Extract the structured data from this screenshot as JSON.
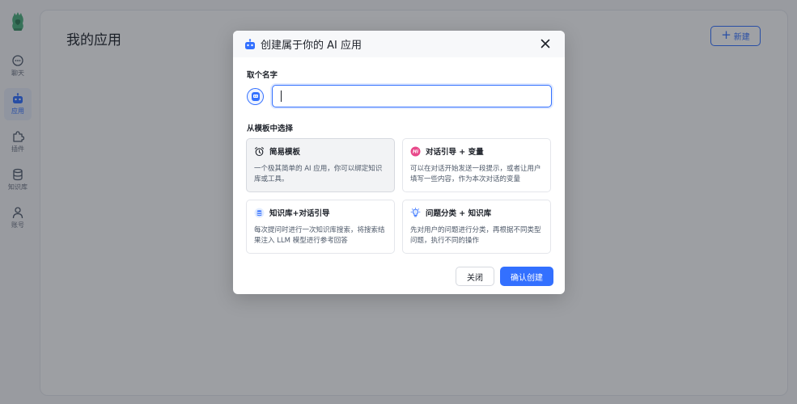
{
  "sidebar": {
    "items": [
      {
        "label": "聊天",
        "icon": "chat-icon"
      },
      {
        "label": "应用",
        "icon": "robot-icon",
        "active": true
      },
      {
        "label": "插件",
        "icon": "puzzle-icon"
      },
      {
        "label": "知识库",
        "icon": "database-icon"
      },
      {
        "label": "账号",
        "icon": "user-icon"
      }
    ]
  },
  "main": {
    "title": "我的应用",
    "new_button": "新建"
  },
  "modal": {
    "title": "创建属于你的 AI 应用",
    "name_label": "取个名字",
    "name_value": "",
    "template_label": "从模板中选择",
    "templates": [
      {
        "title": "简易模板",
        "desc": "一个极其简单的 AI 应用，你可以绑定知识库或工具。",
        "icon": "alarm-clock-icon",
        "selected": true
      },
      {
        "title": "对话引导 + 变量",
        "desc": "可以在对话开始发送一段提示，或者让用户填写一些内容，作为本次对话的变量",
        "icon": "hi-badge-icon"
      },
      {
        "title": "知识库+对话引导",
        "desc": "每次提问时进行一次知识库搜索，将搜索结果注入 LLM 模型进行参考回答",
        "icon": "database-badge-icon"
      },
      {
        "title": "问题分类 + 知识库",
        "desc": "先对用户的问题进行分类，再根据不同类型问题，执行不同的操作",
        "icon": "lightbulb-icon"
      }
    ],
    "close_button": "关闭",
    "confirm_button": "确认创建"
  },
  "colors": {
    "accent": "#3370ff",
    "overlay": "rgba(26,30,40,0.42)"
  }
}
